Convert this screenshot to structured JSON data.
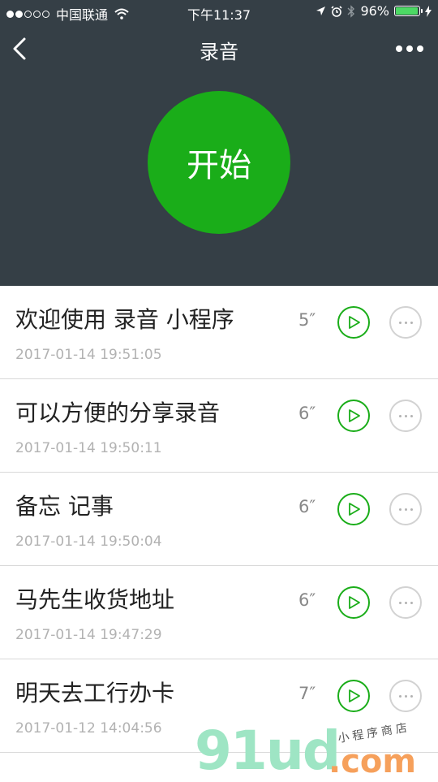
{
  "status_bar": {
    "carrier": "中国联通",
    "time": "下午11:37",
    "battery": "96%",
    "battery_level": 0.96,
    "signal_bars": 2
  },
  "nav": {
    "title": "录音",
    "back_icon": "chevron-left-icon",
    "more_icon": "more-horizontal-icon"
  },
  "record_button": {
    "label": "开始",
    "color": "#1aad19"
  },
  "recordings": [
    {
      "title": "欢迎使用 录音 小程序",
      "datetime": "2017-01-14 19:51:05",
      "duration": "5″"
    },
    {
      "title": "可以方便的分享录音",
      "datetime": "2017-01-14 19:50:11",
      "duration": "6″"
    },
    {
      "title": "备忘 记事",
      "datetime": "2017-01-14 19:50:04",
      "duration": "6″"
    },
    {
      "title": "马先生收货地址",
      "datetime": "2017-01-14 19:47:29",
      "duration": "6″"
    },
    {
      "title": "明天去工行办卡",
      "datetime": "2017-01-12 14:04:56",
      "duration": "7″"
    }
  ],
  "watermark": {
    "logo": "91ud",
    "domain": ".com",
    "caption": "小程序商店"
  },
  "colors": {
    "header_bg": "#353f46",
    "accent": "#1aad19"
  }
}
